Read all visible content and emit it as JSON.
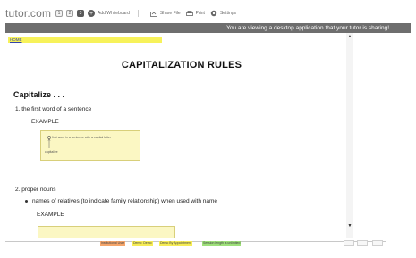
{
  "toolbar": {
    "logo": "tutor.com",
    "pages": [
      "1",
      "2",
      "3"
    ],
    "active_page": "3",
    "add_whiteboard": "Add Whiteboard",
    "share_file": "Share File",
    "print": "Print",
    "settings": "Settings"
  },
  "banner": {
    "message": "You are viewing a desktop application that your tutor is sharing!"
  },
  "document": {
    "home_link": "HOME",
    "title": "CAPITALIZATION RULES",
    "capitalize_heading": "Capitalize . . .",
    "rule1": "1.  the first word of a sentence",
    "example1": "EXAMPLE",
    "note1_text": "first word in a sentence with a capital letter",
    "note1_caption": "capitalize",
    "rule2": "2.  proper nouns",
    "bullet1": "names of relatives (to indicate family relationship) when used with name",
    "example2": "EXAMPLE"
  },
  "status": {
    "chip1": "Institutional User",
    "chip2": "Demo: Demo",
    "chip3": "Demo By Appointment",
    "chip4": "Session length is unlimited"
  },
  "colors": {
    "banner": "#6e6e6e",
    "home_bar": "#f7f25a",
    "note_bg": "#fbf7c3",
    "chip_orange": "#f5a56a",
    "chip_yellow": "#f6ec55",
    "chip_green": "#9ee07a"
  }
}
